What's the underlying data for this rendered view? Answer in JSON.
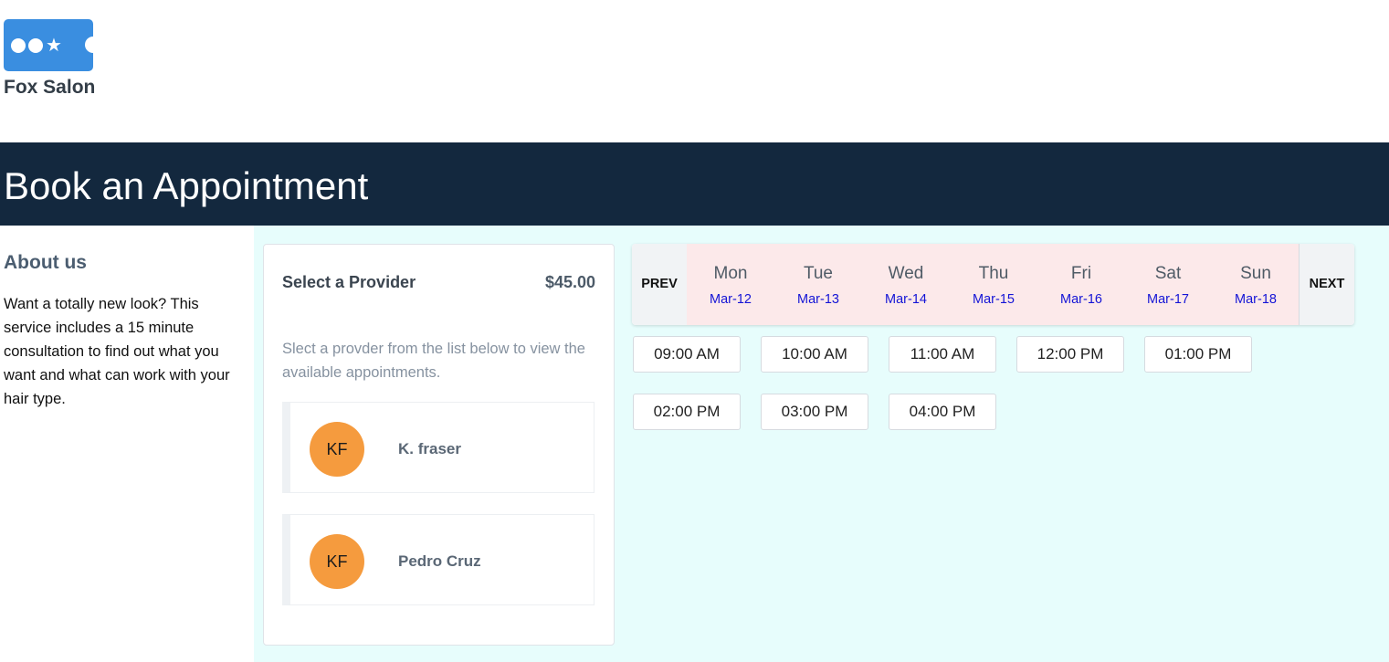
{
  "brand": {
    "name": "Fox Salon",
    "logo_icon": "ticket-icon"
  },
  "banner": {
    "title": "Book an Appointment"
  },
  "about": {
    "heading": "About us",
    "text": "Want a totally new look? This service includes a 15 minute consultation to find out what you want and what can work with your hair type."
  },
  "provider_card": {
    "title": "Select a Provider",
    "price": "$45.00",
    "hint": "Slect a provder from the list below to view the available appointments.",
    "providers": [
      {
        "initials": "KF",
        "name": "K. fraser"
      },
      {
        "initials": "KF",
        "name": "Pedro Cruz"
      }
    ]
  },
  "calendar": {
    "prev_label": "PREV",
    "next_label": "NEXT",
    "days": [
      {
        "name": "Mon",
        "date": "Mar-12"
      },
      {
        "name": "Tue",
        "date": "Mar-13"
      },
      {
        "name": "Wed",
        "date": "Mar-14"
      },
      {
        "name": "Thu",
        "date": "Mar-15"
      },
      {
        "name": "Fri",
        "date": "Mar-16"
      },
      {
        "name": "Sat",
        "date": "Mar-17"
      },
      {
        "name": "Sun",
        "date": "Mar-18"
      }
    ],
    "slots": [
      "09:00 AM",
      "10:00 AM",
      "11:00 AM",
      "12:00 PM",
      "01:00 PM",
      "02:00 PM",
      "03:00 PM",
      "04:00 PM"
    ]
  },
  "colors": {
    "banner_bg": "#13283e",
    "main_bg": "#e7fdfc",
    "days_bg": "#fce9ea",
    "date_link": "#1414d6",
    "avatar": "#f59b3e",
    "logo": "#3a8ee0"
  }
}
